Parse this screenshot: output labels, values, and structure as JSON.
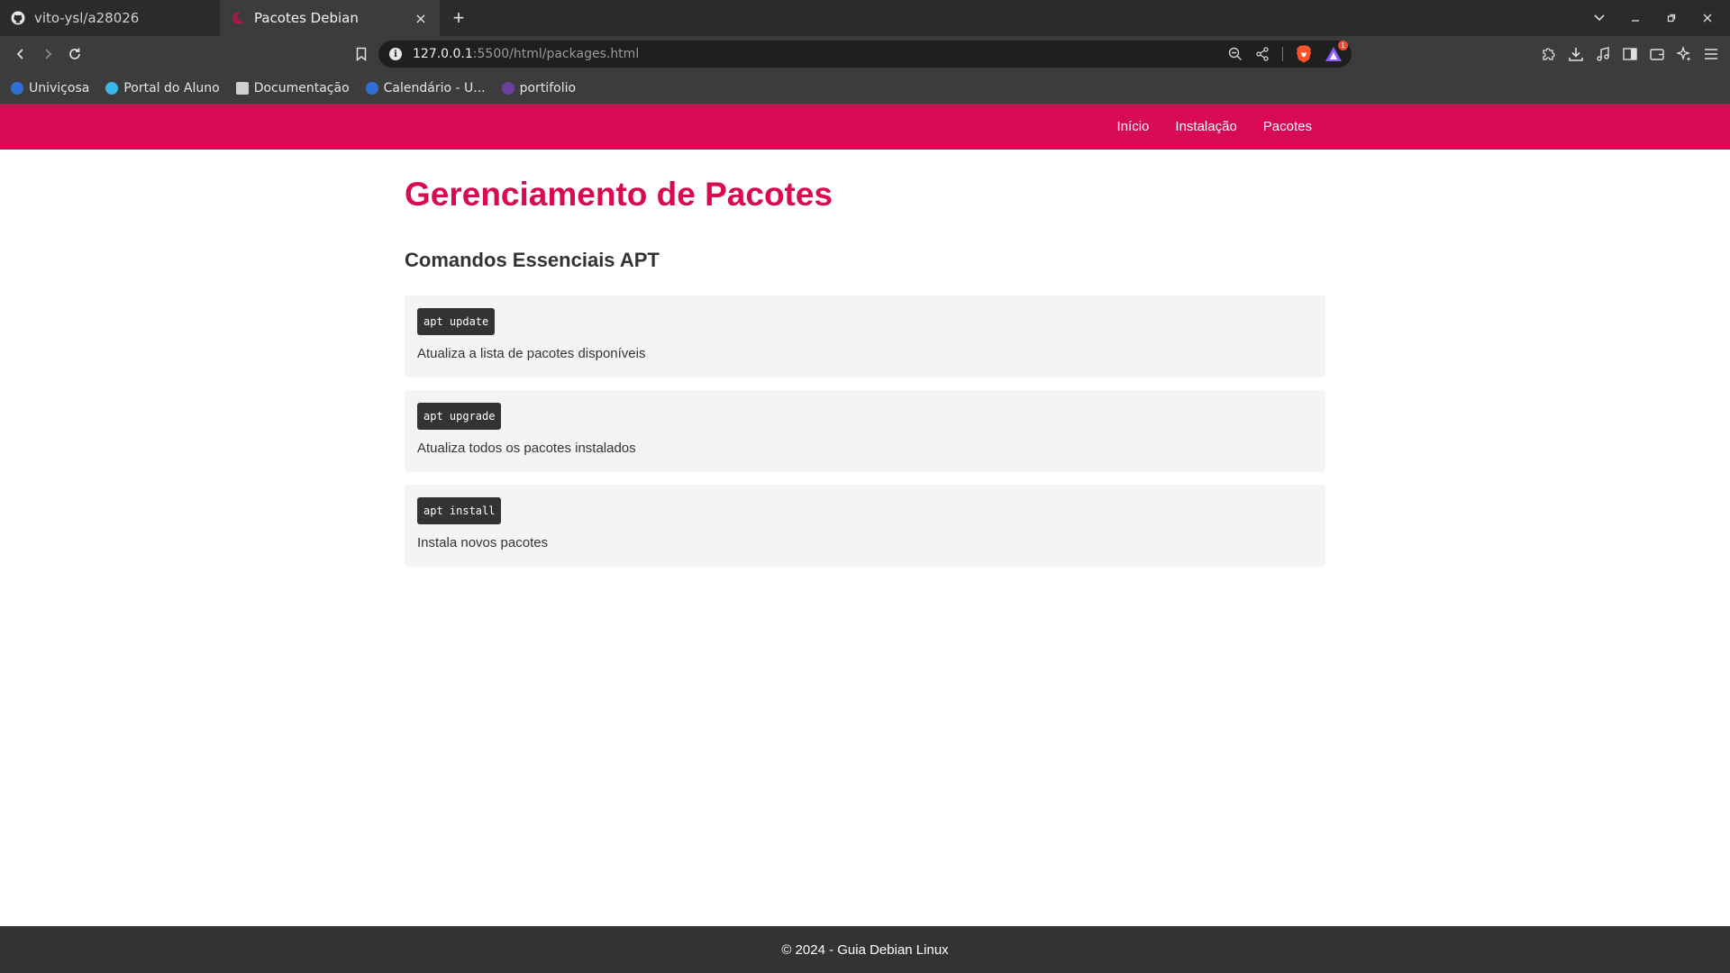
{
  "browser": {
    "tabs": [
      {
        "title": "vito-ysl/a28026",
        "icon": "github-icon",
        "active": false
      },
      {
        "title": "Pacotes Debian",
        "icon": "debian-icon",
        "active": true
      }
    ],
    "new_tab_label": "+",
    "close_tab_label": "×",
    "url_host": "127.0.0.1",
    "url_rest": ":5500/html/packages.html",
    "rewards_badge": "1",
    "bookmarks": [
      {
        "label": "Univiçosa",
        "icon": "univicosa-icon"
      },
      {
        "label": "Portal do Aluno",
        "icon": "portal-icon"
      },
      {
        "label": "Documentação",
        "icon": "doc-icon"
      },
      {
        "label": "Calendário - U...",
        "icon": "calendar-site-icon"
      },
      {
        "label": "portifolio",
        "icon": "portfolio-icon"
      }
    ]
  },
  "site": {
    "brand_color": "#d70a53",
    "nav": [
      {
        "label": "Início"
      },
      {
        "label": "Instalação"
      },
      {
        "label": "Pacotes"
      }
    ],
    "title": "Gerenciamento de Pacotes",
    "section_title": "Comandos Essenciais APT",
    "commands": [
      {
        "code": "apt update",
        "desc": "Atualiza a lista de pacotes disponíveis"
      },
      {
        "code": "apt upgrade",
        "desc": "Atualiza todos os pacotes instalados"
      },
      {
        "code": "apt install",
        "desc": "Instala novos pacotes"
      }
    ],
    "footer": "© 2024 - Guia Debian Linux"
  }
}
